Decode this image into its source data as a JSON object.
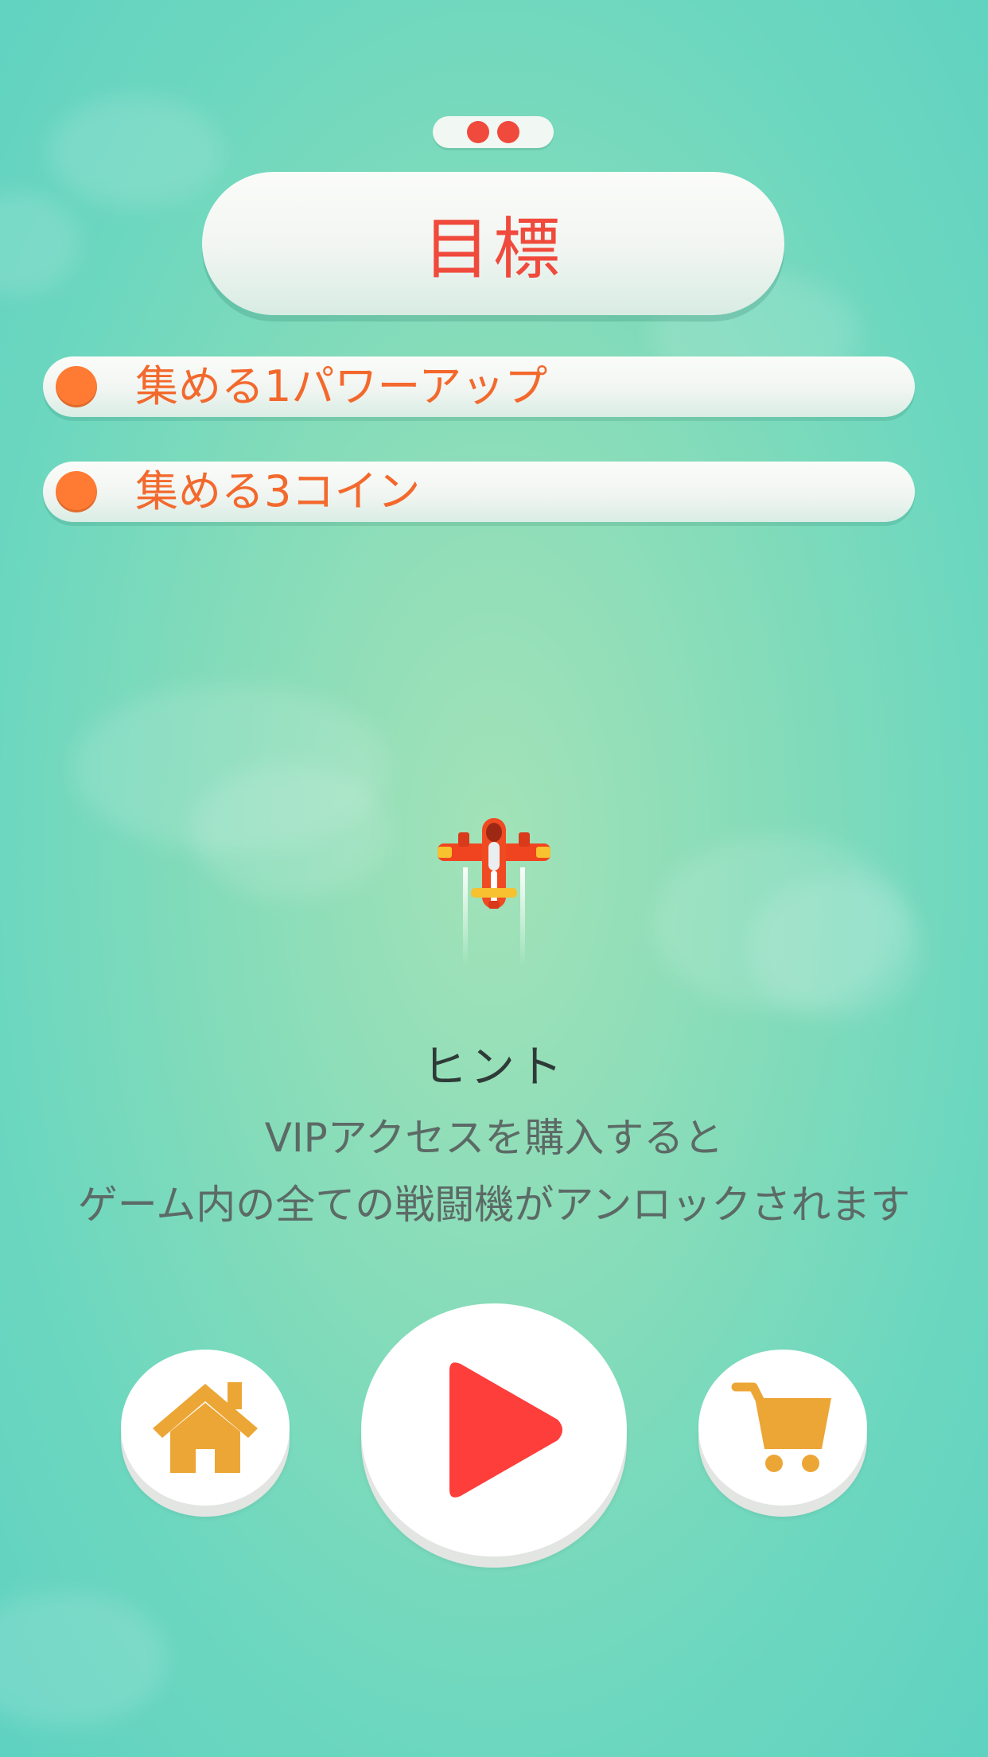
{
  "colors": {
    "accent_red": "#f04a3c",
    "objective_orange": "#f3692d",
    "icon_orange": "#eca636",
    "play_red": "#fd3e3b",
    "hint_dark": "#2f3b38",
    "hint_gray": "#5c6a66"
  },
  "pager": {
    "dots": [
      "active",
      "active"
    ]
  },
  "goal_panel": {
    "title": "目標"
  },
  "objectives": [
    {
      "label": "集める1パワーアップ"
    },
    {
      "label": "集める3コイン"
    }
  ],
  "hint": {
    "title": "ヒント",
    "line1": "VIPアクセスを購入すると",
    "line2": "ゲーム内の全ての戦闘機がアンロックされます"
  },
  "buttons": {
    "home": {
      "icon": "home-icon"
    },
    "play": {
      "icon": "play-icon"
    },
    "shop": {
      "icon": "shopping-cart-icon"
    }
  }
}
